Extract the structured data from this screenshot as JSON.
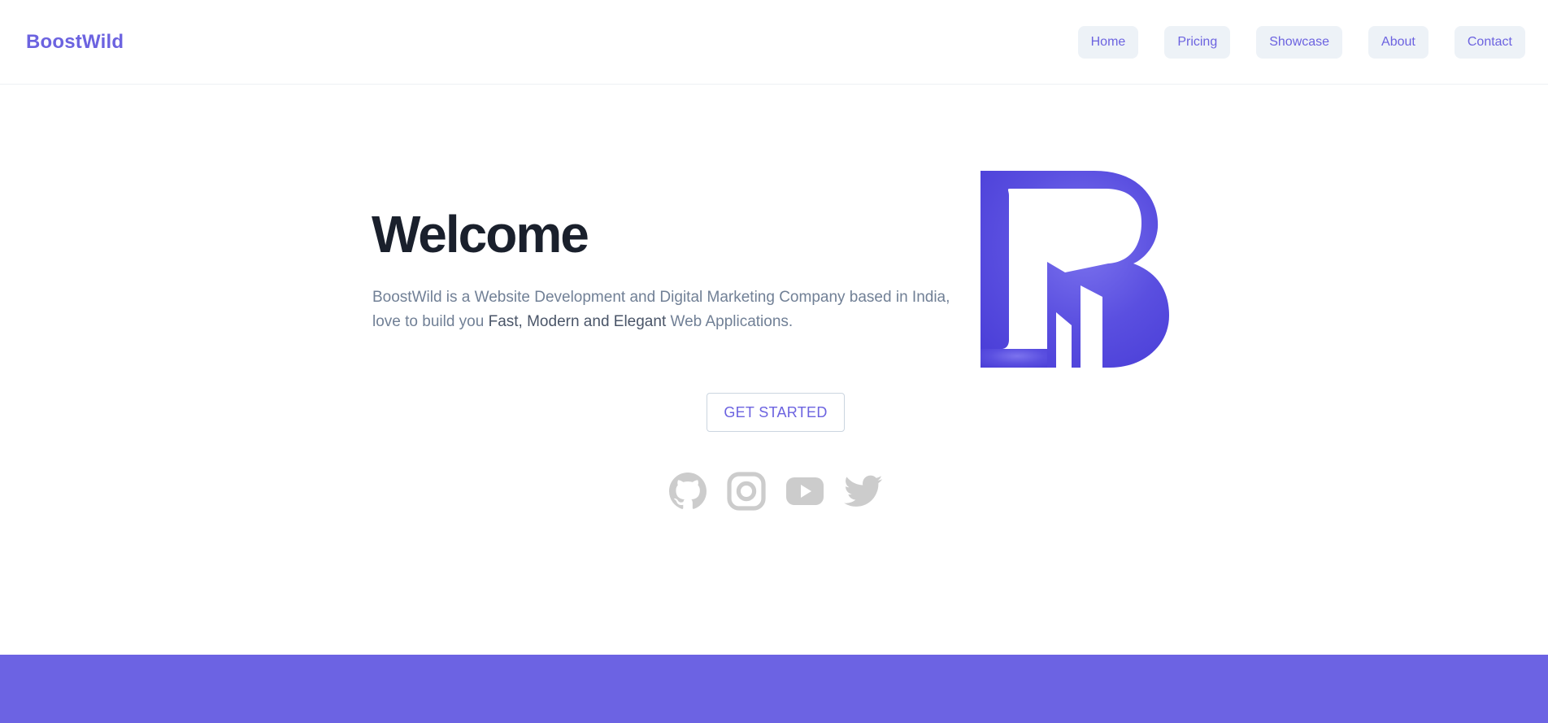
{
  "brand": {
    "name": "BoostWild"
  },
  "nav": {
    "items": [
      {
        "label": "Home"
      },
      {
        "label": "Pricing"
      },
      {
        "label": "Showcase"
      },
      {
        "label": "About"
      },
      {
        "label": "Contact"
      }
    ]
  },
  "hero": {
    "title": "Welcome",
    "desc_part1": "BoostWild is a Website Development and Digital Marketing Company based in India, love to build you ",
    "desc_emphasis": "Fast, Modern and Elegant",
    "desc_part2": " Web Applications.",
    "cta_label": "GET STARTED"
  },
  "logo": {
    "icon": "boostwild-b-logo"
  },
  "socials": [
    {
      "icon": "github-icon"
    },
    {
      "icon": "instagram-icon"
    },
    {
      "icon": "youtube-icon"
    },
    {
      "icon": "twitter-icon"
    }
  ],
  "colors": {
    "accent": "#6c63e0",
    "nav_bg": "#edf2f7",
    "footer_band": "#6c63e3",
    "social_icon": "#cccccc"
  }
}
